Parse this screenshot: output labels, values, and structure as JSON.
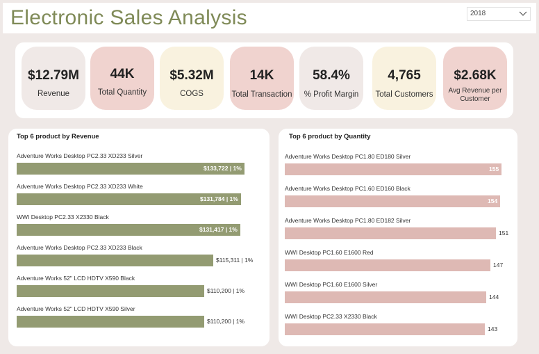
{
  "header": {
    "title": "Electronic Sales Analysis"
  },
  "slicer": {
    "value": "2018"
  },
  "kpis": [
    {
      "value": "$12.79M",
      "label": "Revenue",
      "color": "#f0e9e7"
    },
    {
      "value": "44K",
      "label": "Total Quantity",
      "color": "#f0d3cf"
    },
    {
      "value": "$5.32M",
      "label": "COGS",
      "color": "#f9f2df"
    },
    {
      "value": "14K",
      "label": "Total Transaction",
      "color": "#f0d3cf"
    },
    {
      "value": "58.4%",
      "label": "% Profit Margin",
      "color": "#f0e9e7"
    },
    {
      "value": "4,765",
      "label": "Total Customers",
      "color": "#f9f2df"
    },
    {
      "value": "$2.68K",
      "label": "Avg Revenue per Customer",
      "color": "#f0d3cf"
    }
  ],
  "chart_data": [
    {
      "type": "bar",
      "orientation": "horizontal",
      "title": "Top 6 product by Revenue",
      "categories": [
        "Adventure Works Desktop PC2.33 XD233 Silver",
        "Adventure Works Desktop PC2.33 XD233 White",
        "WWI Desktop PC2.33 X2330 Black",
        "Adventure Works Desktop PC2.33 XD233 Black",
        "Adventure Works 52\" LCD HDTV X590 Black",
        "Adventure Works 52\" LCD HDTV X590 Silver"
      ],
      "values": [
        133722,
        131784,
        131417,
        115311,
        110200,
        110200
      ],
      "data_labels": [
        "$133,722 | 1%",
        "$131,784 | 1%",
        "$131,417 | 1%",
        "$115,311 | 1%",
        "$110,200 | 1%",
        "$110,200 | 1%"
      ],
      "color": "#939b72"
    },
    {
      "type": "bar",
      "orientation": "horizontal",
      "title": "Top 6 product by Quantity",
      "categories": [
        "Adventure Works Desktop PC1.80 ED180 Silver",
        "Adventure Works Desktop PC1.60 ED160 Black",
        "Adventure Works Desktop PC1.80 ED182 Silver",
        "WWI Desktop PC1.60 E1600 Red",
        "WWI Desktop PC1.60 E1600 Silver",
        "WWI Desktop PC2.33 X2330 Black"
      ],
      "values": [
        155,
        154,
        151,
        147,
        144,
        143
      ],
      "data_labels": [
        "155",
        "154",
        "151",
        "147",
        "144",
        "143"
      ],
      "color": "#deb9b4"
    }
  ]
}
